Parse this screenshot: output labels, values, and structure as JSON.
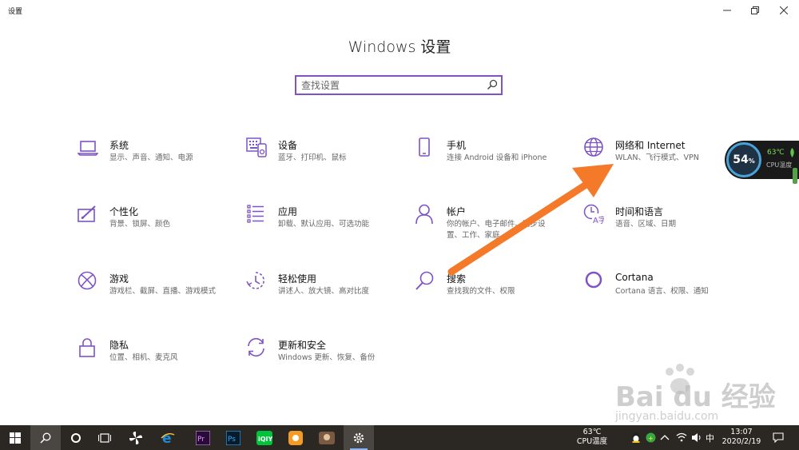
{
  "window": {
    "title": "设置"
  },
  "header": {
    "title": "Windows 设置"
  },
  "search": {
    "placeholder": "查找设置"
  },
  "categories": [
    {
      "icon": "laptop-icon",
      "title": "系统",
      "subtitle": "显示、声音、通知、电源"
    },
    {
      "icon": "keyboard-icon",
      "title": "设备",
      "subtitle": "蓝牙、打印机、鼠标"
    },
    {
      "icon": "phone-icon",
      "title": "手机",
      "subtitle": "连接 Android 设备和 iPhone"
    },
    {
      "icon": "globe-icon",
      "title": "网络和 Internet",
      "subtitle": "WLAN、飞行模式、VPN"
    },
    {
      "icon": "paint-icon",
      "title": "个性化",
      "subtitle": "背景、锁屏、颜色"
    },
    {
      "icon": "apps-list-icon",
      "title": "应用",
      "subtitle": "卸载、默认应用、可选功能"
    },
    {
      "icon": "person-icon",
      "title": "帐户",
      "subtitle": "你的帐户、电子邮件、同步设置、工作、家庭",
      "subtitle_lines": [
        "你的帐户、电子邮件、同步设",
        "置、工作、家庭"
      ]
    },
    {
      "icon": "time-language-icon",
      "title": "时间和语言",
      "subtitle": "语音、区域、日期"
    },
    {
      "icon": "xbox-icon",
      "title": "游戏",
      "subtitle": "游戏栏、截屏、直播、游戏模式"
    },
    {
      "icon": "ease-of-access-icon",
      "title": "轻松使用",
      "subtitle": "讲述人、放大镜、高对比度"
    },
    {
      "icon": "search-icon",
      "title": "搜索",
      "subtitle": "查找我的文件、权限"
    },
    {
      "icon": "cortana-icon",
      "title": "Cortana",
      "subtitle": "Cortana 语言、权限、通知"
    },
    {
      "icon": "lock-icon",
      "title": "隐私",
      "subtitle": "位置、相机、麦克风"
    },
    {
      "icon": "update-icon",
      "title": "更新和安全",
      "subtitle": "Windows 更新、恢复、备份"
    }
  ],
  "cpu_widget": {
    "percent": "54",
    "percent_unit": "%",
    "temp": "63℃",
    "label": "CPU温度"
  },
  "taskbar": {
    "apps": [
      "start-icon",
      "search-icon",
      "cortana-icon",
      "task-view-icon",
      "pinwheel-icon",
      "edge-icon",
      "premiere-icon",
      "photoshop-icon",
      "iqiyi-icon",
      "app-orange-icon",
      "game-icon",
      "settings-icon"
    ],
    "tray_temp": "63℃",
    "tray_temp_label": "CPU温度",
    "ime": "中",
    "time": "13:07",
    "date": "2020/2/19"
  },
  "watermark": {
    "main": "Bai du 经验",
    "sub": "jingyan.baidu.com"
  },
  "colors": {
    "accent": "#7d53c7",
    "arrow": "#f47a2a",
    "taskbar": "#2b2723"
  }
}
